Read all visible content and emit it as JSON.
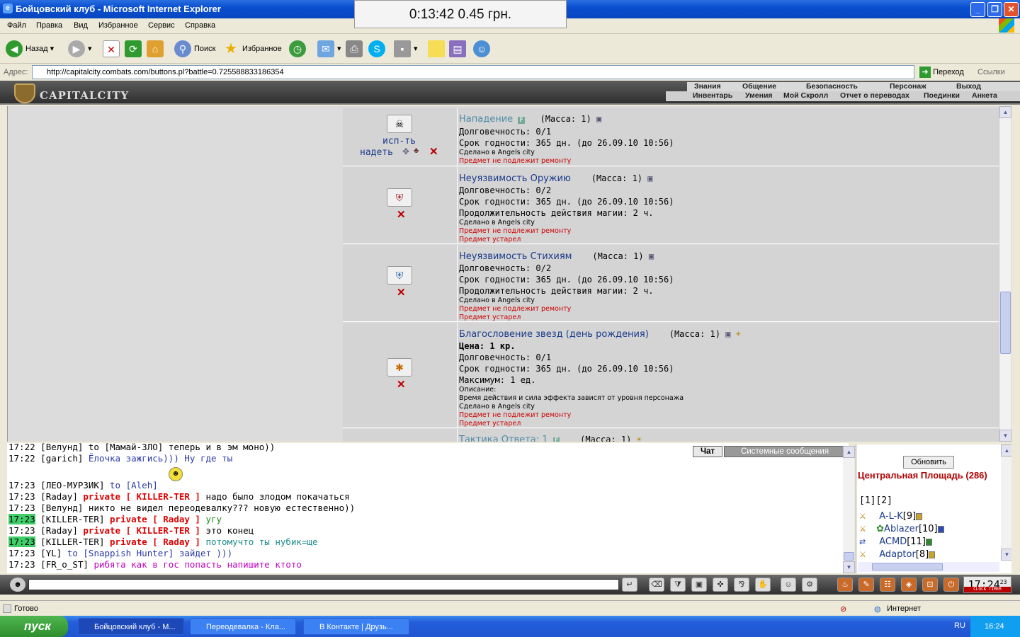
{
  "window": {
    "title": "Бойцовский клуб - Microsoft Internet Explorer"
  },
  "timer": "0:13:42  0.45 грн.",
  "menu": [
    "Файл",
    "Правка",
    "Вид",
    "Избранное",
    "Сервис",
    "Справка"
  ],
  "toolbar": {
    "back": "Назад",
    "search": "Поиск",
    "favorites": "Избранное"
  },
  "address": {
    "label": "Адрес:",
    "url": "http://capitalcity.combats.com/buttons.pl?battle=0.725588833186354",
    "go": "Переход",
    "links": "Ссылки"
  },
  "cc": {
    "logo": "CAPITALCITY",
    "nav1": [
      "Знания",
      "Общение",
      "Безопасность",
      "Персонаж",
      "Выход"
    ],
    "nav2": [
      "Инвентарь",
      "Умения",
      "Мой Скролл",
      "Отчет о переводах",
      "Поединки",
      "Анкета"
    ]
  },
  "items": [
    {
      "name": "Нападение",
      "mass": "(Масса: 1)",
      "lines": [
        "Долговечность: 0/1",
        "Срок годности: 365 дн. (до 26.09.10 10:56)"
      ],
      "small": [
        "Сделано в Angels city"
      ],
      "red": [
        "Предмет не подлежит ремонту"
      ],
      "use": "исп-ть",
      "wear": "надеть"
    },
    {
      "name": "Неуязвимость Оружию",
      "mass": "(Масса: 1)",
      "lines": [
        "Долговечность: 0/2",
        "Срок годности: 365 дн. (до 26.09.10 10:56)",
        "Продолжительность действия магии: 2 ч."
      ],
      "small": [
        "Сделано в Angels city"
      ],
      "red": [
        "Предмет не подлежит ремонту",
        "Предмет устарел"
      ]
    },
    {
      "name": "Неуязвимость Стихиям",
      "mass": "(Масса: 1)",
      "lines": [
        "Долговечность: 0/2",
        "Срок годности: 365 дн. (до 26.09.10 10:56)",
        "Продолжительность действия магии: 2 ч."
      ],
      "small": [
        "Сделано в Angels city"
      ],
      "red": [
        "Предмет не подлежит ремонту",
        "Предмет устарел"
      ]
    },
    {
      "name": "Благословение звезд (день рождения)",
      "mass": "(Масса: 1)",
      "price": "Цена: 1 кр.",
      "lines": [
        "Долговечность: 0/1",
        "Срок годности: 365 дн. (до 26.09.10 10:56)",
        "Максимум: 1 ед."
      ],
      "small": [
        "Описание:",
        "Время действия и сила эффекта зависят от уровня персонажа",
        "Сделано в Angels city"
      ],
      "red": [
        "Предмет не подлежит ремонту",
        "Предмет устарел"
      ]
    },
    {
      "name": "Тактика Ответа: 1",
      "mass": "(Масса: 1)"
    }
  ],
  "chat": {
    "tabs": [
      "Чат",
      "Системные сообщения"
    ],
    "lines": [
      {
        "time": "17:22",
        "text": "[Велунд] to [Мамай-ЗЛО] теперь и в эм моно))"
      },
      {
        "time": "17:22",
        "name": "[garich]",
        "msg": "Ёлочка зажгись))) Ну где ты"
      },
      {
        "time": "17:23",
        "name": "[ЛЕО-МУРЗИК]",
        "msg": "to [Aleh]"
      },
      {
        "time": "17:23",
        "name": "[Raday]",
        "priv": "private [ KILLER-TER ]",
        "msg": "надо было злодом покачаться"
      },
      {
        "time": "17:23",
        "name": "[Велунд]",
        "msg": "никто не видел переодевалку??? новую естественно))"
      },
      {
        "time": "17:23",
        "name": "[KILLER-TER]",
        "priv": "private [ Raday ]",
        "msg": "угу"
      },
      {
        "time": "17:23",
        "name": "[Raday]",
        "priv": "private [ KILLER-TER ]",
        "msg": "это конец"
      },
      {
        "time": "17:23",
        "name": "[KILLER-TER]",
        "priv": "private [ Raday ]",
        "msg": "потомучто ты нубик=ще"
      },
      {
        "time": "17:23",
        "name": "[YL]",
        "msg": "to [Snappish Hunter] зайдет )))"
      },
      {
        "time": "17:23",
        "name": "[FR_o_ST]",
        "msg": "рибята как в гос попасть напишите ктото"
      }
    ]
  },
  "users": {
    "refresh": "Обновить",
    "room": "Центральная Площадь (286)",
    "pages": "[1][2]",
    "list": [
      {
        "name": "A-L-K",
        "level": "[9]"
      },
      {
        "name": "Ablazer",
        "level": "[10]"
      },
      {
        "name": "ACMD",
        "level": "[11]"
      },
      {
        "name": "Adaptor",
        "level": "[8]"
      }
    ]
  },
  "clock": {
    "time": "17:24",
    "sec": "23",
    "label": "CLOCK TIMER"
  },
  "status": {
    "ready": "Готово",
    "zone": "Интернет"
  },
  "taskbar": {
    "start": "пуск",
    "tasks": [
      "Бойцовский клуб - М...",
      "Переодевалка - Кла...",
      "В Контакте | Друзь..."
    ],
    "lang": "RU",
    "time": "16:24"
  }
}
